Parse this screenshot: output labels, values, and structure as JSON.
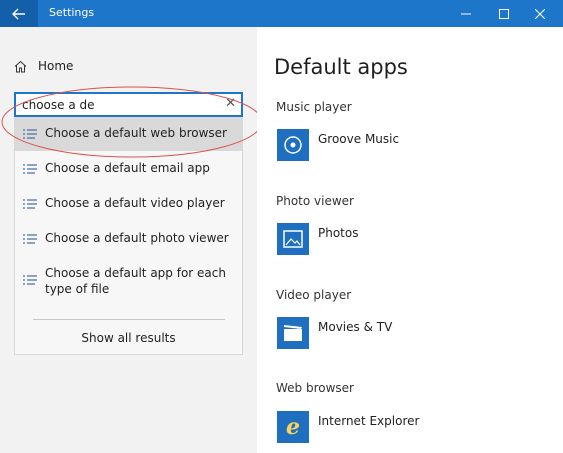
{
  "window": {
    "title": "Settings",
    "back_icon": "back-arrow-icon",
    "controls": [
      "minimize-icon",
      "maximize-icon",
      "close-icon"
    ]
  },
  "sidebar": {
    "home_label": "Home",
    "search": {
      "value": "choose a de",
      "clear_icon": "clear-icon"
    },
    "results": [
      {
        "label": "Choose a default web browser",
        "selected": true
      },
      {
        "label": "Choose a default email app",
        "selected": false
      },
      {
        "label": "Choose a default video player",
        "selected": false
      },
      {
        "label": "Choose a default photo viewer",
        "selected": false
      },
      {
        "label": "Choose a default app for each type of file",
        "selected": false
      }
    ],
    "show_all_label": "Show all results"
  },
  "main": {
    "title": "Default apps",
    "sections": [
      {
        "label": "Music player",
        "app": "Groove Music",
        "icon": "groove-music-icon"
      },
      {
        "label": "Photo viewer",
        "app": "Photos",
        "icon": "photos-icon"
      },
      {
        "label": "Video player",
        "app": "Movies & TV",
        "icon": "movies-tv-icon"
      },
      {
        "label": "Web browser",
        "app": "Internet Explorer",
        "icon": "internet-explorer-icon"
      }
    ]
  },
  "colors": {
    "accent": "#1e76ca",
    "accent_dark": "#135fa9",
    "sidebar_bg": "#f2f2f2",
    "selected_bg": "#d9d9d9",
    "app_tile": "#1e6fc0",
    "annotation_ring": "#d9534f"
  }
}
